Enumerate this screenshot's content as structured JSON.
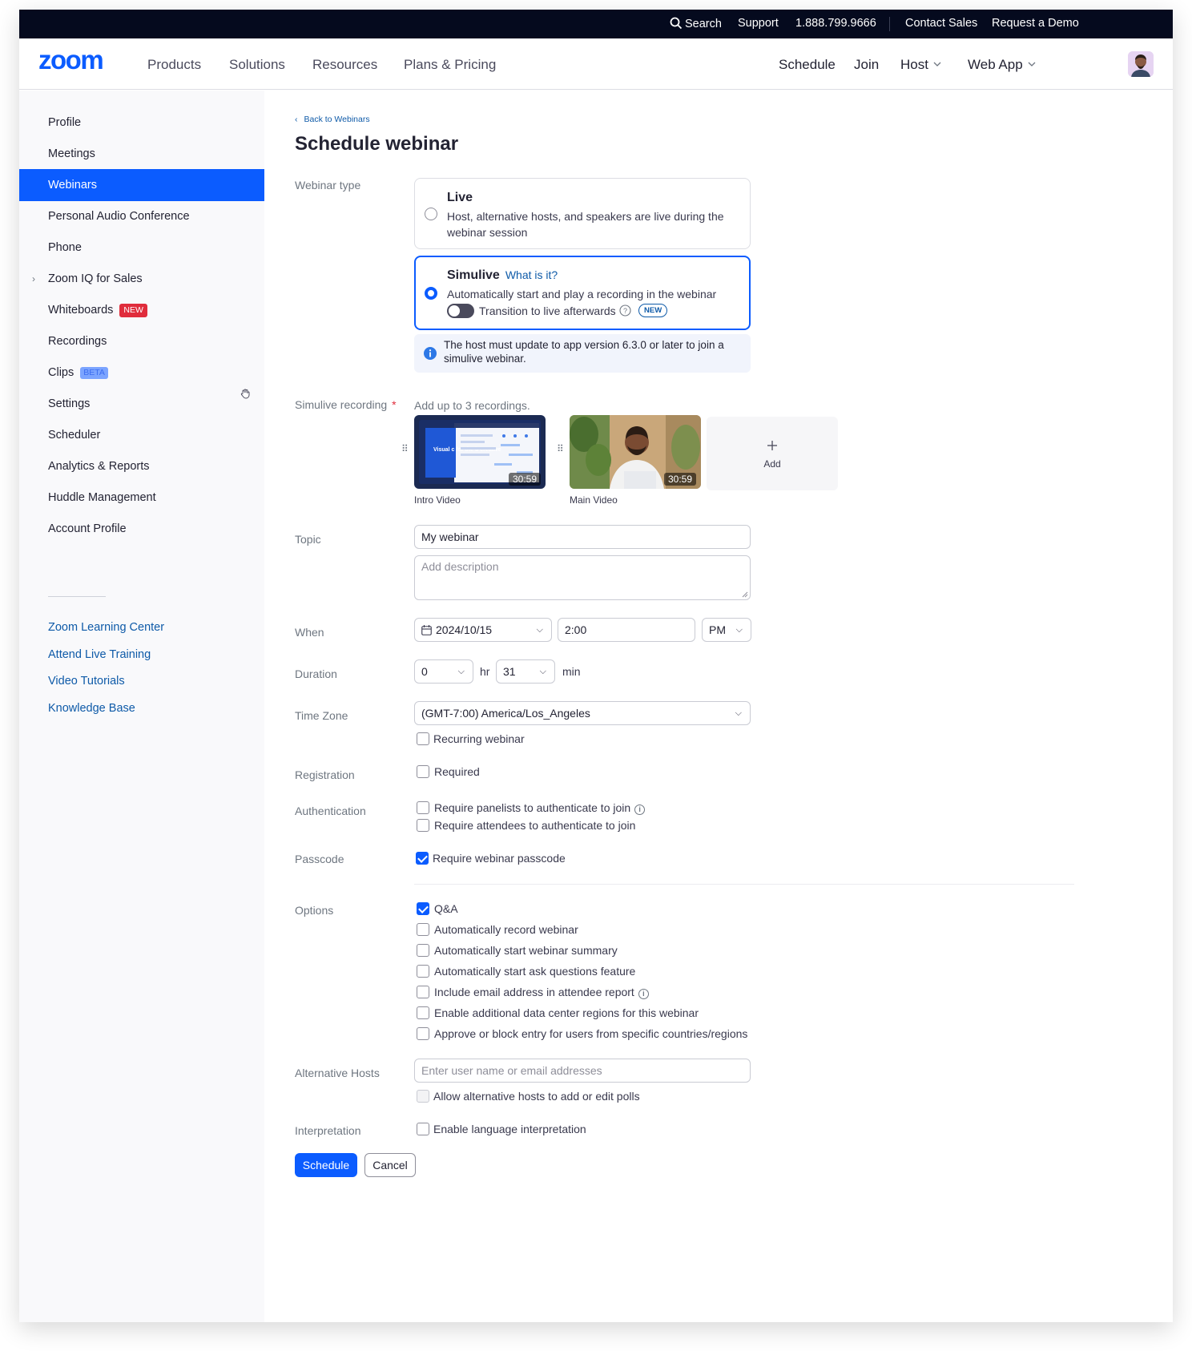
{
  "topbar": {
    "search": "Search",
    "support": "Support",
    "phone": "1.888.799.9666",
    "contact_sales": "Contact Sales",
    "request_demo": "Request a Demo"
  },
  "nav": {
    "logo": "zoom",
    "products": "Products",
    "solutions": "Solutions",
    "resources": "Resources",
    "plans": "Plans & Pricing",
    "schedule": "Schedule",
    "join": "Join",
    "host": "Host",
    "web_app": "Web App"
  },
  "sidebar": {
    "items": [
      {
        "label": "Profile"
      },
      {
        "label": "Meetings"
      },
      {
        "label": "Webinars"
      },
      {
        "label": "Personal Audio  Conference"
      },
      {
        "label": "Phone"
      },
      {
        "label": "Zoom IQ for Sales"
      },
      {
        "label": "Whiteboards",
        "badge": "NEW"
      },
      {
        "label": "Recordings"
      },
      {
        "label": "Clips",
        "badge": "BETA"
      },
      {
        "label": "Settings"
      },
      {
        "label": "Scheduler"
      },
      {
        "label": "Analytics & Reports"
      },
      {
        "label": "Huddle Management"
      },
      {
        "label": "Account Profile"
      }
    ],
    "links": [
      "Zoom Learning Center",
      "Attend Live Training",
      "Video Tutorials",
      "Knowledge Base"
    ]
  },
  "page": {
    "back": "Back to Webinars",
    "title": "Schedule webinar"
  },
  "labels": {
    "webinar_type": "Webinar type",
    "simulive_recording": "Simulive recording",
    "required_mark": "*",
    "topic": "Topic",
    "when": "When",
    "duration": "Duration",
    "time_zone": "Time Zone",
    "registration": "Registration",
    "authentication": "Authentication",
    "passcode": "Passcode",
    "options": "Options",
    "alternative_hosts": "Alternative Hosts",
    "interpretation": "Interpretation"
  },
  "webinar_type": {
    "live": {
      "title": "Live",
      "desc": "Host, alternative hosts, and speakers are live during the webinar session",
      "selected": false
    },
    "simulive": {
      "title": "Simulive",
      "what": "What is it?",
      "desc": "Automatically start and play a recording in the webinar",
      "toggle_label": "Transition to live afterwards",
      "toggle_on": false,
      "new": "NEW",
      "selected": true
    },
    "info": "The host must update to app version 6.3.0 or later to join a simulive webinar."
  },
  "recordings": {
    "hint": "Add up to 3 recordings.",
    "items": [
      {
        "caption": "Intro Video",
        "duration": "30:59",
        "overlay_text": "Visual c for the b creative"
      },
      {
        "caption": "Main Video",
        "duration": "30:59"
      }
    ],
    "add": "Add"
  },
  "topic": {
    "value": "My webinar",
    "desc_placeholder": "Add description"
  },
  "when": {
    "date": "2024/10/15",
    "time": "2:00",
    "ampm": "PM"
  },
  "duration": {
    "hours": "0",
    "hr_unit": "hr",
    "minutes": "31",
    "min_unit": "min"
  },
  "timezone": {
    "value": "(GMT-7:00) America/Los_Angeles",
    "recurring": "Recurring webinar",
    "recurring_checked": false
  },
  "registration": {
    "label": "Required",
    "checked": false
  },
  "authentication": {
    "panelists": "Require panelists to authenticate to join",
    "attendees": "Require attendees to authenticate to join"
  },
  "passcode": {
    "label": "Require webinar passcode",
    "checked": true
  },
  "options": [
    {
      "label": "Q&A",
      "checked": true
    },
    {
      "label": "Automatically record webinar",
      "checked": false
    },
    {
      "label": "Automatically start webinar summary",
      "checked": false
    },
    {
      "label": "Automatically start ask questions feature",
      "checked": false
    },
    {
      "label": "Include email address in attendee report",
      "checked": false
    },
    {
      "label": "Enable additional data center regions for this webinar",
      "checked": false
    },
    {
      "label": "Approve or block entry for users from specific countries/regions",
      "checked": false
    }
  ],
  "alt_hosts": {
    "placeholder": "Enter user name or email addresses",
    "polls": "Allow alternative hosts to add or edit polls"
  },
  "interpretation": {
    "label": "Enable language interpretation"
  },
  "actions": {
    "schedule": "Schedule",
    "cancel": "Cancel"
  },
  "colors": {
    "accent": "#0b5cff",
    "topbar": "#050a1e",
    "link": "#0e5aa8",
    "danger": "#e02d3c"
  }
}
